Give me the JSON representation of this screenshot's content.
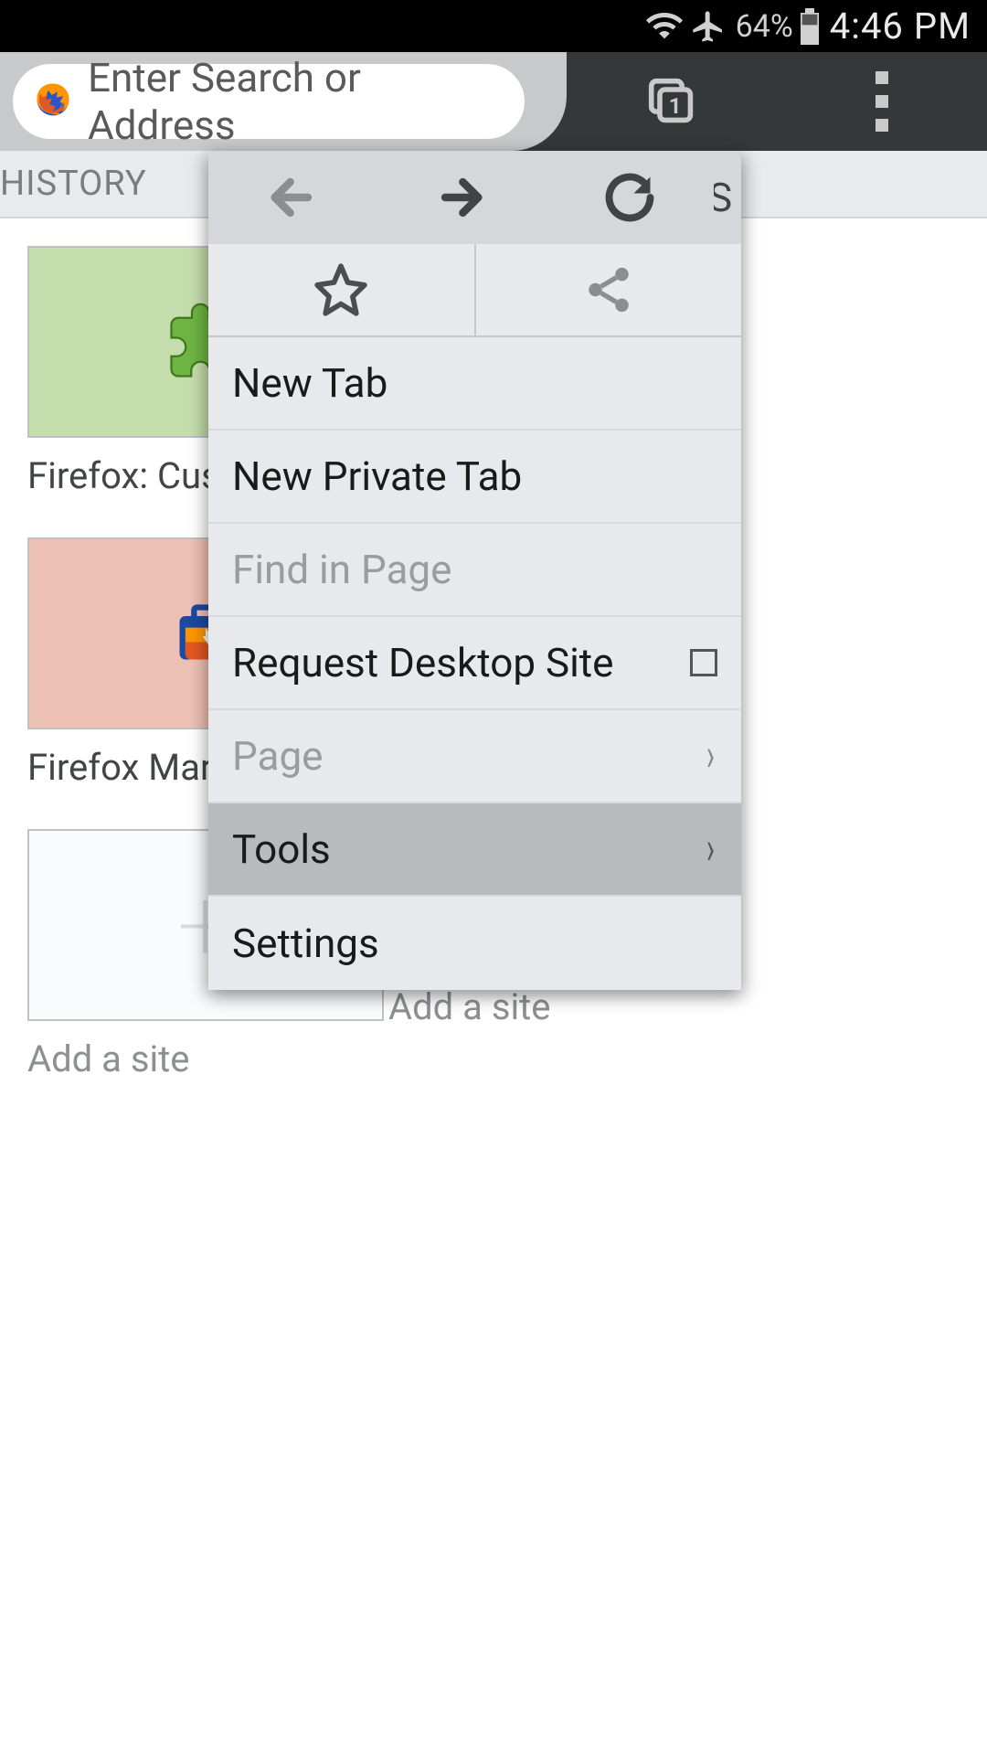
{
  "status": {
    "battery_pct": "64%",
    "clock": "4:46 PM"
  },
  "toolbar": {
    "url_placeholder": "Enter Search or Address",
    "tab_count": "1"
  },
  "page": {
    "history_label": "HISTORY",
    "tiles": [
      {
        "label": "Firefox: Customi",
        "thumb_class": "green"
      },
      {
        "label": "Firefox Marketpl",
        "thumb_class": "pink"
      },
      {
        "label": "Add a site",
        "thumb_class": "empty"
      }
    ],
    "add_site_label_col2": "Add a site"
  },
  "menu": {
    "items": {
      "new_tab": "New Tab",
      "new_private_tab": "New Private Tab",
      "find_in_page": "Find in Page",
      "request_desktop": "Request Desktop Site",
      "page": "Page",
      "tools": "Tools",
      "settings": "Settings"
    }
  }
}
